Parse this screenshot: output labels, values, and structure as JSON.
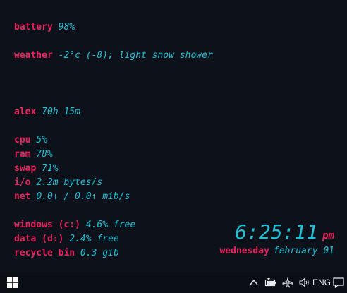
{
  "widgets": {
    "battery": {
      "label": "battery",
      "value": "98%"
    },
    "weather": {
      "label": "weather",
      "value": "-2°c (-8); light snow shower"
    },
    "uptime": {
      "label": "alex",
      "value": "70h 15m"
    },
    "cpu": {
      "label": "cpu",
      "value": "5%"
    },
    "ram": {
      "label": "ram",
      "value": "78%"
    },
    "swap": {
      "label": "swap",
      "value": "71%"
    },
    "io": {
      "label": "i/o",
      "value": "2.2m bytes/s"
    },
    "net": {
      "label": "net",
      "value": "0.0⇂ / 0.0↿ mib/s"
    },
    "windows_drive": {
      "label": "windows (c:)",
      "value": "4.6% free"
    },
    "data_drive": {
      "label": "data (d:)",
      "value": "2.4% free"
    },
    "recycle_bin": {
      "label": "recycle bin",
      "value": "0.3 gib"
    }
  },
  "clock": {
    "time": "6:25:11",
    "ampm": "pm",
    "weekday": "wednesday",
    "date": "february 01"
  },
  "taskbar": {
    "start_icon": "windows-logo",
    "tray_icons": [
      "chevron-up-icon",
      "battery-icon",
      "airplane-icon",
      "volume-icon"
    ],
    "language": "ENG",
    "notification_icon": "notification-icon"
  },
  "colors": {
    "background": "#0d111a",
    "label": "#e8245e",
    "value": "#1fc1d6"
  }
}
